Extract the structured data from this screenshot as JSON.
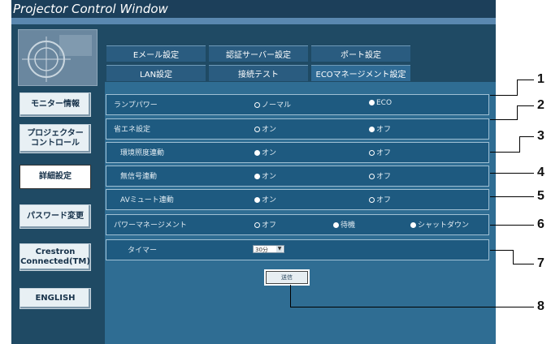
{
  "window": {
    "title": "Projector Control Window"
  },
  "sidebar": {
    "items": [
      {
        "label": "モニター情報"
      },
      {
        "label": "プロジェクター\nコントロール"
      },
      {
        "label": "詳細設定"
      },
      {
        "label": "パスワード変更"
      },
      {
        "label": "Crestron\nConnected(TM)"
      },
      {
        "label": "ENGLISH"
      }
    ]
  },
  "tabs": [
    {
      "label": "Eメール設定"
    },
    {
      "label": "認証サーバー設定"
    },
    {
      "label": "ポート設定"
    },
    {
      "label": "LAN設定"
    },
    {
      "label": "接続テスト"
    },
    {
      "label": "ECOマネージメント設定"
    }
  ],
  "rows": {
    "lamp_power": {
      "label": "ランプパワー",
      "opt1": "ノーマル",
      "opt2": "ECO"
    },
    "power_save": {
      "label": "省エネ設定",
      "opt1": "オン",
      "opt2": "オフ"
    },
    "ambient_light": {
      "label": "環境照度連動",
      "opt1": "オン",
      "opt2": "オフ"
    },
    "no_signal": {
      "label": "無信号連動",
      "opt1": "オン",
      "opt2": "オフ"
    },
    "av_mute": {
      "label": "AVミュート連動",
      "opt1": "オン",
      "opt2": "オフ"
    },
    "power_management": {
      "label": "パワーマネージメント",
      "opt1": "オフ",
      "opt2": "待機",
      "opt3": "シャットダウン"
    },
    "timer": {
      "label": "タイマー",
      "value": "30分"
    }
  },
  "send_label": "送信",
  "callouts": [
    "1",
    "2",
    "3",
    "4",
    "5",
    "6",
    "7",
    "8"
  ]
}
